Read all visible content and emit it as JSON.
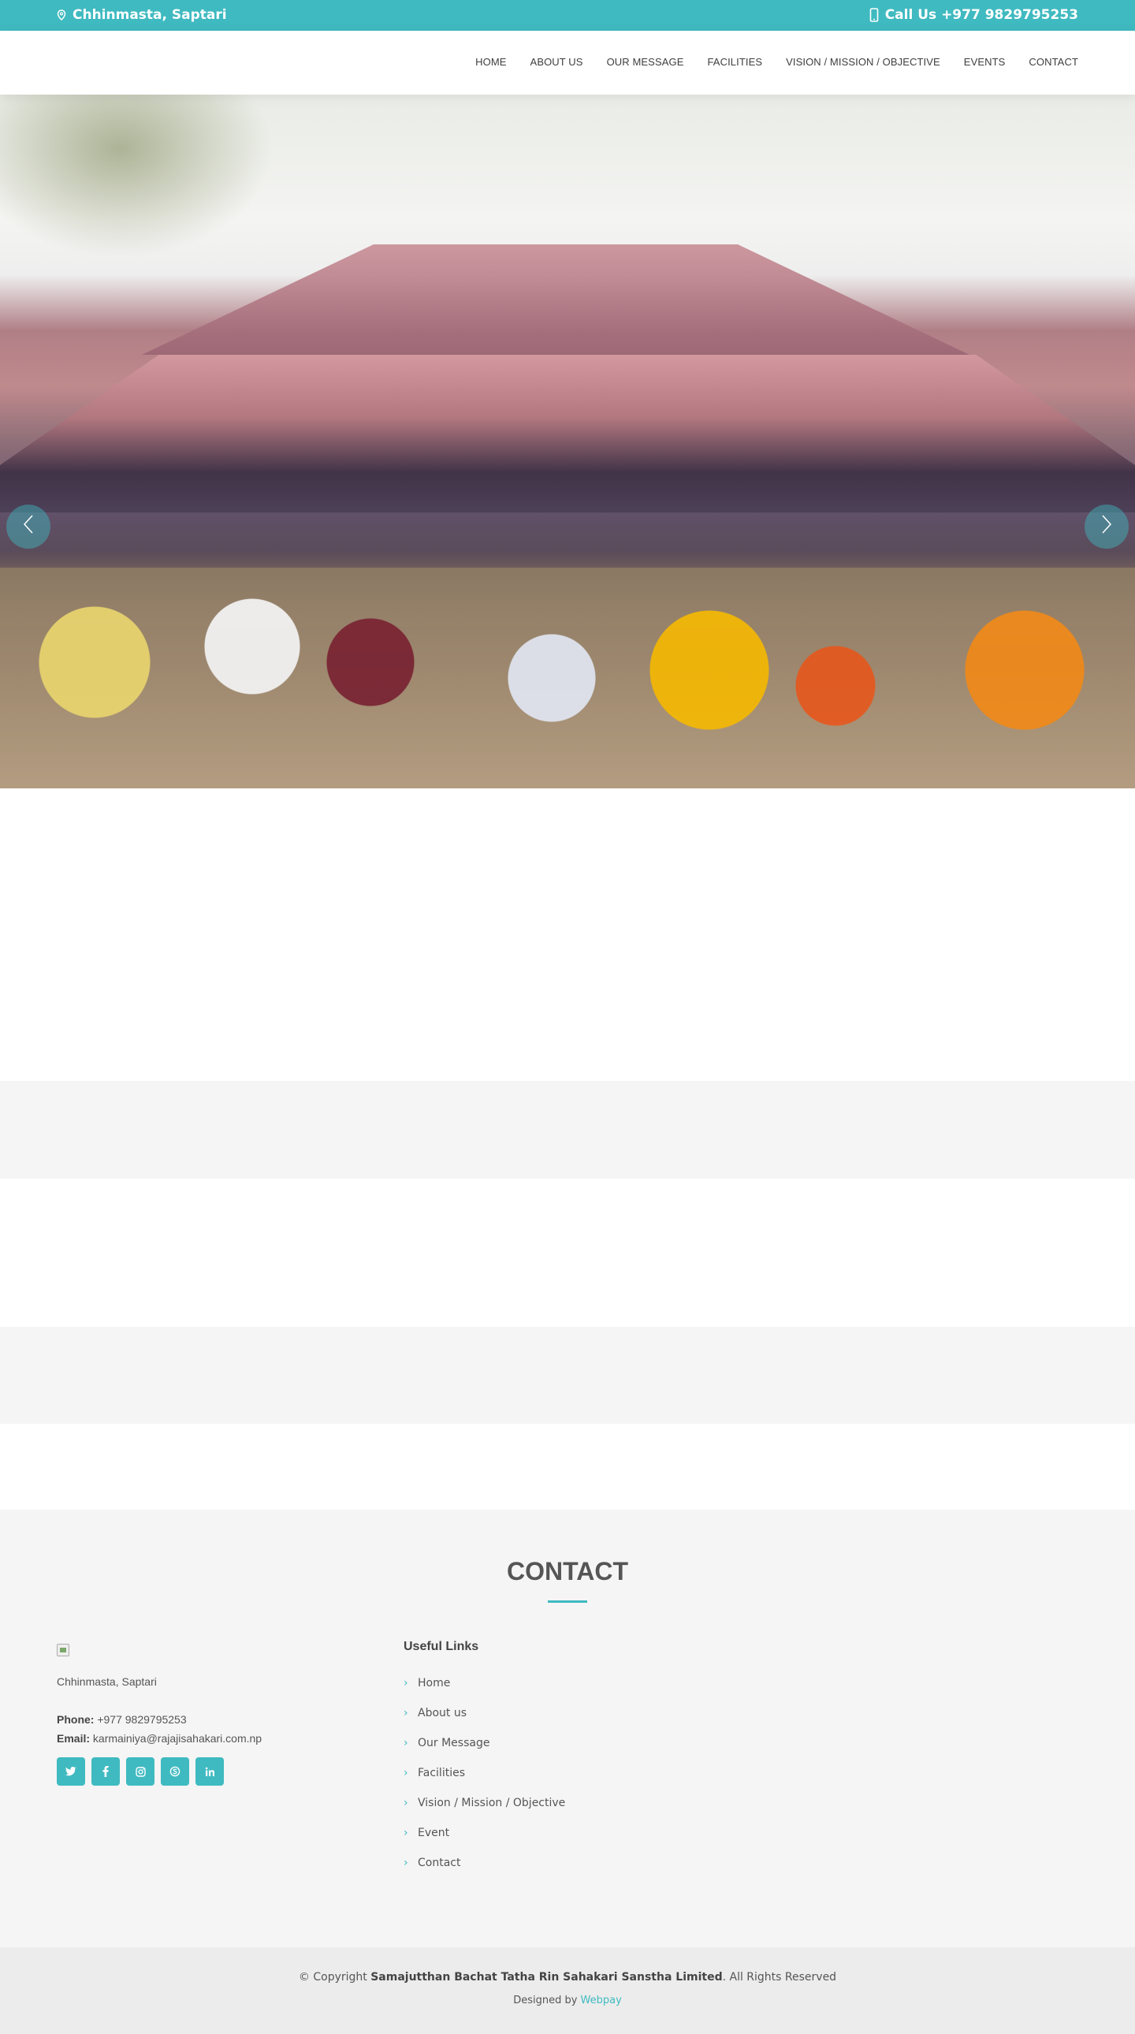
{
  "topbar": {
    "location": "Chhinmasta, Saptari",
    "call": "Call Us +977 9829795253",
    "accent": "#3fbac0"
  },
  "nav": {
    "items": [
      "HOME",
      "ABOUT US",
      "OUR MESSAGE",
      "FACILITIES",
      "VISION / MISSION / OBJECTIVE",
      "EVENTS",
      "CONTACT"
    ]
  },
  "hero": {
    "prev_icon": "chevron-left-icon",
    "next_icon": "chevron-right-icon",
    "slides_count": 3,
    "active_slide": 1
  },
  "contact": {
    "title": "CONTACT",
    "address": "Chhinmasta, Saptari",
    "phone_label": "Phone:",
    "phone": "+977 9829795253",
    "email_label": "Email:",
    "email": "karmainiya@rajajisahakari.com.np",
    "social": [
      "twitter-icon",
      "facebook-icon",
      "instagram-icon",
      "skype-icon",
      "linkedin-icon"
    ]
  },
  "useful_links": {
    "title": "Useful Links",
    "items": [
      "Home",
      "About us",
      "Our Message",
      "Facilities",
      "Vision / Mission / Objective",
      "Event",
      "Contact"
    ]
  },
  "footer": {
    "copyright_prefix": "© Copyright",
    "company": "Samajutthan Bachat Tatha Rin Sahakari Sanstha Limited",
    "copyright_suffix": ". All Rights Reserved",
    "designed_by": "Designed by",
    "designer": "Webpay"
  }
}
